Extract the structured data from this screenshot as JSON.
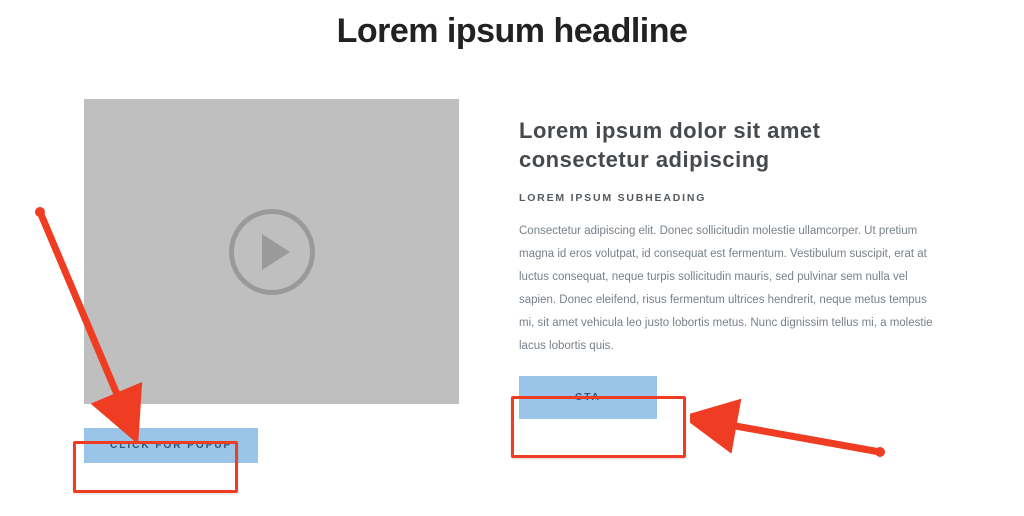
{
  "headline": "Lorem ipsum headline",
  "left": {
    "popup_button_label": "CLICK FOR POPUP"
  },
  "right": {
    "heading": "Lorem ipsum dolor sit amet consectetur adipiscing",
    "subheading": "LOREM IPSUM SUBHEADING",
    "body": "Consectetur adipiscing elit. Donec sollicitudin molestie ullamcorper. Ut pretium magna id eros volutpat, id consequat est fermentum. Vestibulum suscipit, erat at luctus consequat, neque turpis sollicitudin mauris, sed pulvinar sem nulla vel sapien. Donec eleifend, risus fermentum ultrices hendrerit, neque metus tempus mi, sit amet vehicula leo justo lobortis metus. Nunc dignissim tellus mi, a molestie lacus lobortis quis.",
    "cta_label": "CTA"
  },
  "annotations": {
    "arrow_color": "#ef3d24"
  }
}
